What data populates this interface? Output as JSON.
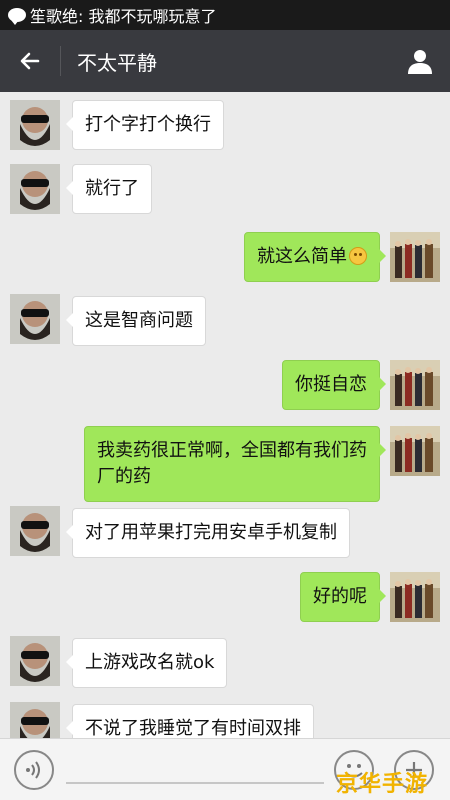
{
  "status_bar": {
    "notification_text": "笙歌绝: 我都不玩哪玩意了",
    "icon": "wechat-icon"
  },
  "header": {
    "title": "不太平静",
    "back_icon": "back-arrow-icon",
    "profile_icon": "user-profile-icon"
  },
  "messages": [
    {
      "side": "in",
      "text": "打个字打个换行"
    },
    {
      "side": "in",
      "text": "就行了"
    },
    {
      "side": "out",
      "text": "就这么简单",
      "emoji": "smile-emoji-icon"
    },
    {
      "side": "in",
      "text": "这是智商问题"
    },
    {
      "side": "out",
      "text": "你挺自恋"
    },
    {
      "side": "out",
      "text": "我卖药很正常啊，全国都有我们药",
      "text2": "厂的药"
    },
    {
      "side": "in",
      "text": "对了用苹果打完用安卓手机复制"
    },
    {
      "side": "out",
      "text": "好的呢"
    },
    {
      "side": "in",
      "text": "上游戏改名就ok"
    },
    {
      "side": "in",
      "text": "不说了我睡觉了有时间双排"
    }
  ],
  "input_bar": {
    "voice_icon": "voice-icon",
    "emoji_icon": "emoji-icon",
    "plus_icon": "plus-icon"
  },
  "watermark": "京华手游网",
  "colors": {
    "title_bar": "#393a3f",
    "status_bar": "#1a1a1a",
    "chat_bg": "#ebebeb",
    "outgoing_bubble": "#a0e75a",
    "incoming_bubble": "#ffffff",
    "watermark": "#f1b300"
  }
}
